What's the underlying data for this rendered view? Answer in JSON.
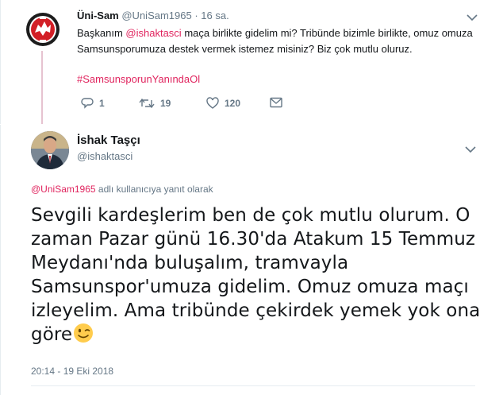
{
  "parent_tweet": {
    "display_name": "Üni-Sam",
    "handle": "@UniSam1965",
    "time": "· 16 sa.",
    "text_part1": "Başkanım ",
    "mention": "@ishaktasci",
    "text_part2": " maça birlikte gidelim mi? Tribünde bizimle birlikte, omuz omuza Samsunsporumuza destek vermek istemez misiniz? Biz çok mutlu oluruz.",
    "hashtag": "#SamsunsporunYanındaOl",
    "replies": "1",
    "retweets": "19",
    "likes": "120",
    "accent_color": "#e0245e"
  },
  "main_tweet": {
    "display_name": "İshak Taşçı",
    "handle": "@ishaktasci",
    "reply_mention": "@UniSam1965",
    "reply_suffix": " adlı kullanıcıya yanıt olarak",
    "text": "Sevgili kardeşlerim ben de çok mutlu olurum. O zaman Pazar günü 16.30'da Atakum 15 Temmuz Meydanı'nda buluşalım, tramvayla Samsunspor'umuza gidelim. Omuz omuza maçı izleyelim. Ama tribünde çekirdek yemek yok ona göre",
    "emoji": "winking-face",
    "timestamp": "20:14 - 19 Eki 2018"
  },
  "icons": {
    "reply": "reply-icon",
    "retweet": "retweet-icon",
    "like": "heart-icon",
    "dm": "envelope-icon",
    "menu": "chevron-down-icon"
  }
}
